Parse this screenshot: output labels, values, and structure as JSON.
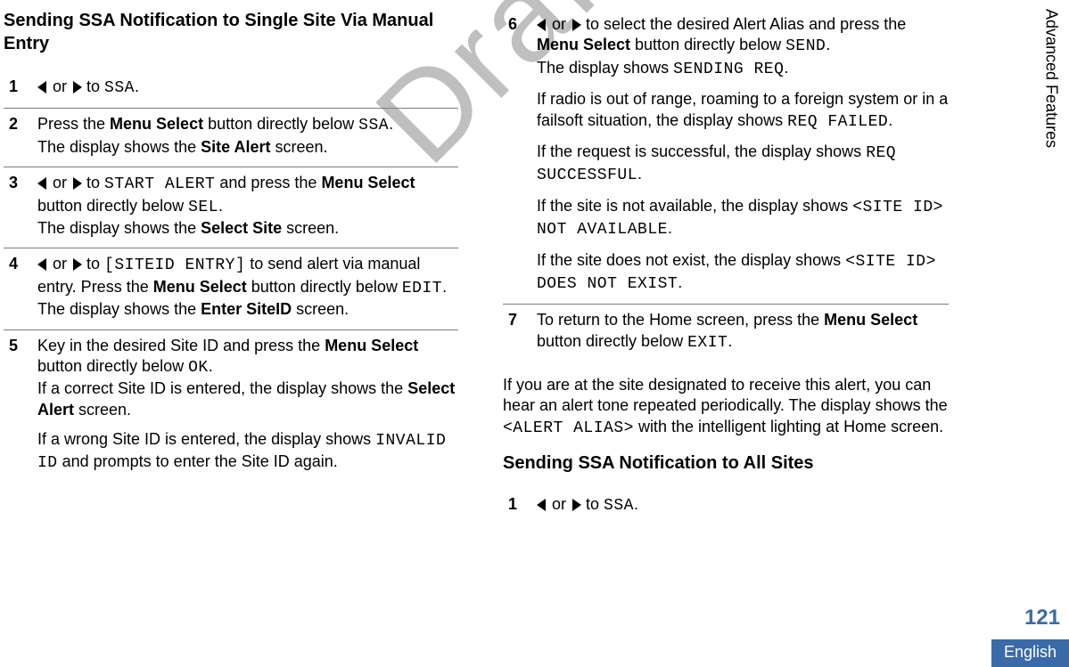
{
  "watermark": "Draft",
  "sideTab": "Advanced Features",
  "pageNumber": "121",
  "language": "English",
  "col1": {
    "title": "Sending SSA Notification to Single Site Via Manual Entry",
    "steps": {
      "s1": {
        "or": " or ",
        "to": " to ",
        "ssa": "SSA",
        "end": "."
      },
      "s2": {
        "t1": "Press the ",
        "b1": "Menu Select",
        "t2": " button directly below ",
        "m1": "SSA",
        "t3": ".",
        "t4": "The display shows the ",
        "b2": "Site Alert",
        "t5": " screen."
      },
      "s3": {
        "or": " or ",
        "to": " to ",
        "m1": "START ALERT",
        "t1": " and press the ",
        "b1": "Menu Select",
        "t2": " button directly below ",
        "m2": "SEL",
        "t3": ".",
        "t4": "The display shows the ",
        "b2": "Select Site",
        "t5": " screen."
      },
      "s4": {
        "or": " or ",
        "to": " to ",
        "m1": "[SITEID ENTRY]",
        "t1": " to send alert via manual entry. Press the ",
        "b1": "Menu Select",
        "t2": " button directly below ",
        "m2": "EDIT",
        "t3": ".",
        "t4": "The display shows the ",
        "b2": "Enter SiteID",
        "t5": " screen."
      },
      "s5": {
        "t1": "Key in the desired Site ID and press the ",
        "b1": "Menu Select",
        "t2": " button directly below ",
        "m1": "OK",
        "t3": ".",
        "t4": "If a correct Site ID is entered, the display shows the ",
        "b2": "Select Alert",
        "t5": " screen.",
        "t6": "If a wrong Site ID is entered, the display shows ",
        "m2": "INVALID ID",
        "t7": " and prompts to enter the Site ID again."
      }
    }
  },
  "col2": {
    "steps": {
      "s6": {
        "or": " or ",
        "t1": " to select the desired Alert Alias and press the ",
        "b1": "Menu Select",
        "t2": " button directly below ",
        "m1": "SEND",
        "t3": ".",
        "t4": "The display shows ",
        "m2": "SENDING REQ",
        "t5": ".",
        "p2a": "If radio is out of range, roaming to a foreign system or in a failsoft situation, the display shows ",
        "m3": "REQ FAILED",
        "p2b": ".",
        "p3a": "If the request is successful, the display shows ",
        "m4": "REQ SUCCESSFUL",
        "p3b": ".",
        "p4a": "If the site is not available, the display shows ",
        "m5": "<SITE ID> NOT AVAILABLE",
        "p4b": ".",
        "p5a": "If the site does not exist, the display shows ",
        "m6": "<SITE ID> DOES NOT EXIST",
        "p5b": "."
      },
      "s7": {
        "t1": "To return to the Home screen, press the ",
        "b1": "Menu Select",
        "t2": " button directly below ",
        "m1": "EXIT",
        "t3": "."
      }
    },
    "note": {
      "t1": "If you are at the site designated to receive this alert, you can hear an alert tone repeated periodically. The display shows the ",
      "m1": "<ALERT ALIAS>",
      "t2": " with the intelligent lighting at Home screen."
    },
    "title2": "Sending SSA Notification to All Sites",
    "steps2": {
      "s1": {
        "or": " or ",
        "to": " to ",
        "ssa": "SSA",
        "end": "."
      }
    }
  }
}
